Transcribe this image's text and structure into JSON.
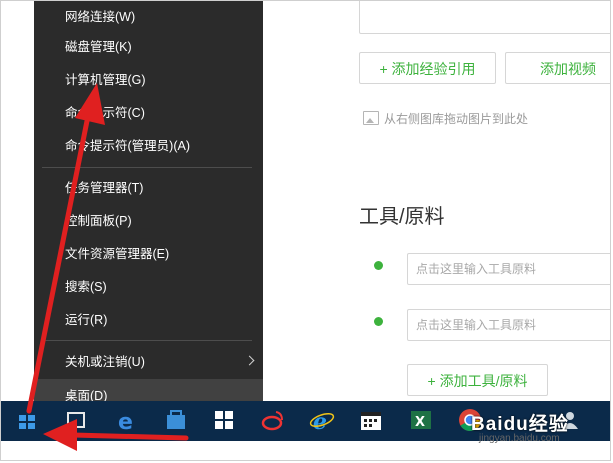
{
  "editor": {
    "add_reference_label": "+ 添加经验引用",
    "add_video_label": "添加视频",
    "drag_hint": "从右侧图库拖动图片到此处",
    "tools_title": "工具/原料",
    "tool_placeholder_1": "点击这里输入工具原料",
    "tool_placeholder_2": "点击这里输入工具原料",
    "add_tool_label": "+ 添加工具/原料"
  },
  "start_menu": {
    "items": [
      {
        "label": "网络连接(W)"
      },
      {
        "label": "磁盘管理(K)"
      },
      {
        "label": "计算机管理(G)"
      },
      {
        "label": "命令提示符(C)"
      },
      {
        "label": "命令提示符(管理员)(A)"
      },
      {
        "label": "任务管理器(T)"
      },
      {
        "label": "控制面板(P)"
      },
      {
        "label": "文件资源管理器(E)"
      },
      {
        "label": "搜索(S)"
      },
      {
        "label": "运行(R)"
      },
      {
        "label": "关机或注销(U)"
      },
      {
        "label": "桌面(D)"
      }
    ]
  },
  "watermark": {
    "brand": "Baidu经验",
    "url": "jingyan.baidu.com"
  },
  "colors": {
    "accent_green": "#3db23d",
    "menu_bg": "#2b2b2b",
    "taskbar_bg": "#0b2a4a",
    "arrow_red": "#e02020"
  },
  "taskbar": {
    "icons": [
      "windows-start-icon",
      "task-view-icon",
      "edge-icon",
      "store-icon",
      "windows-logo-icon",
      "weibo-icon",
      "ie-icon",
      "calendar-icon",
      "excel-icon",
      "chrome-icon",
      "people-icon"
    ]
  }
}
